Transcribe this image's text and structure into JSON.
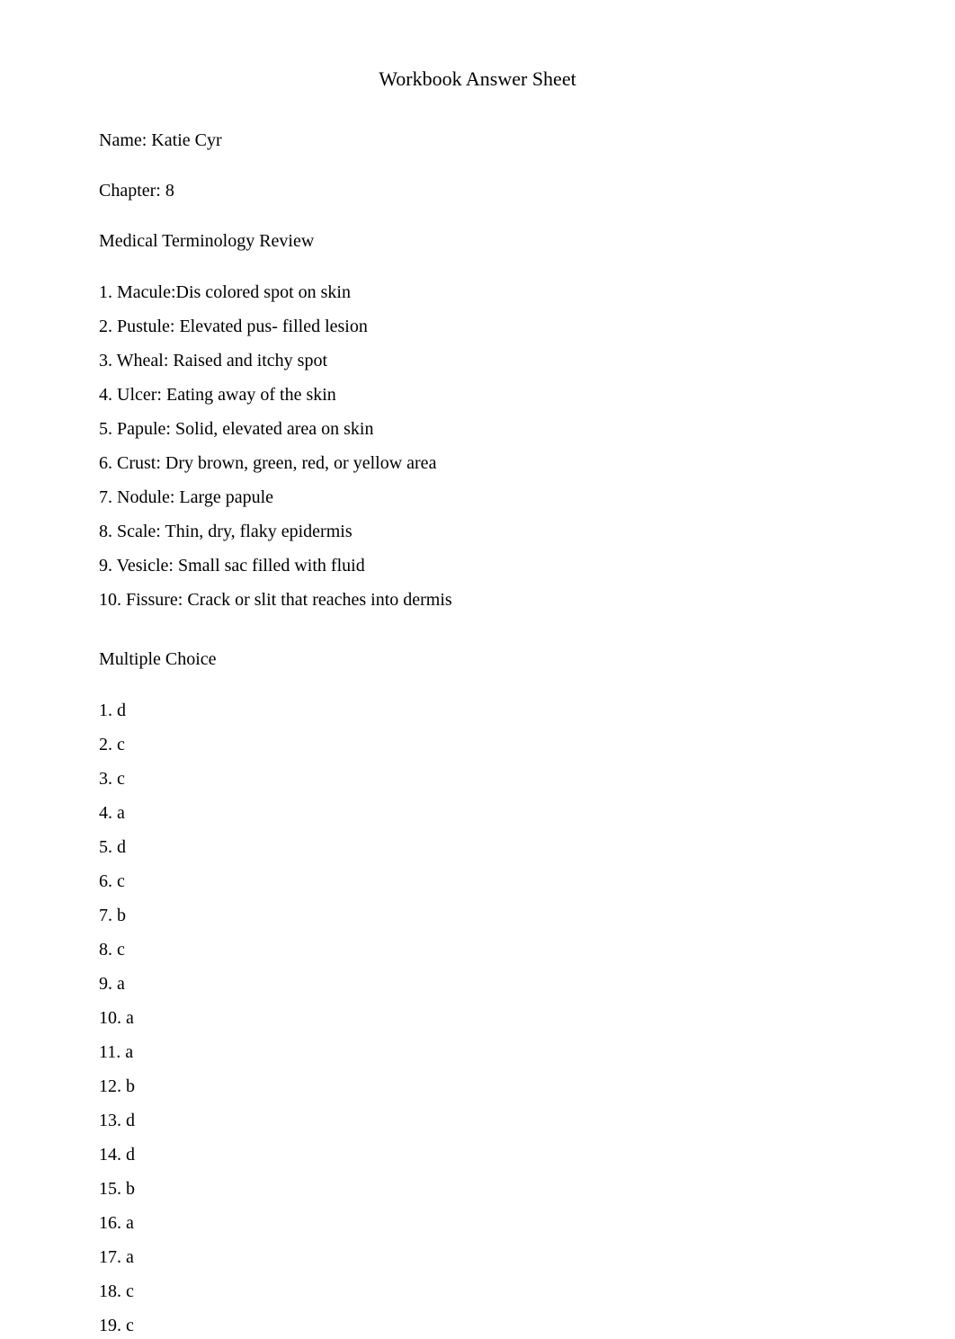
{
  "title": "Workbook Answer Sheet",
  "name_line": "Name: Katie Cyr",
  "chapter_line": "Chapter: 8",
  "term_review_heading": "Medical Terminology Review",
  "terminology": [
    "1. Macule:Dis colored spot on skin",
    "2. Pustule: Elevated pus- filled lesion",
    "3. Wheal: Raised and itchy spot",
    "4. Ulcer: Eating away of the skin",
    "5. Papule: Solid, elevated area on skin",
    "6. Crust: Dry brown, green, red, or yellow area",
    "7. Nodule: Large papule",
    "8. Scale: Thin, dry, flaky epidermis",
    "9. Vesicle: Small sac filled with fluid",
    "10. Fissure: Crack or slit that reaches into dermis"
  ],
  "mc_heading": "Multiple Choice",
  "mc": [
    "1.  d",
    "2. c",
    "3. c",
    "4. a",
    "5. d",
    "6. c",
    "7. b",
    "8. c",
    "9.  a",
    "10. a",
    "11. a",
    "12. b",
    "13. d",
    "14. d",
    "15.  b",
    "16. a",
    "17. a",
    "18. c",
    "19. c"
  ]
}
